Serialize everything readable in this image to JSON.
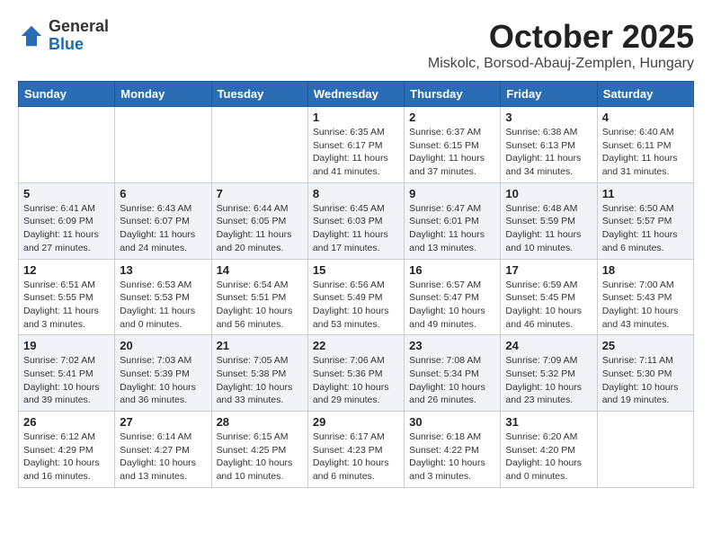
{
  "header": {
    "logo": {
      "general": "General",
      "blue": "Blue"
    },
    "month": "October 2025",
    "location": "Miskolc, Borsod-Abauj-Zemplen, Hungary"
  },
  "weekdays": [
    "Sunday",
    "Monday",
    "Tuesday",
    "Wednesday",
    "Thursday",
    "Friday",
    "Saturday"
  ],
  "weeks": [
    [
      {
        "day": "",
        "info": ""
      },
      {
        "day": "",
        "info": ""
      },
      {
        "day": "",
        "info": ""
      },
      {
        "day": "1",
        "info": "Sunrise: 6:35 AM\nSunset: 6:17 PM\nDaylight: 11 hours\nand 41 minutes."
      },
      {
        "day": "2",
        "info": "Sunrise: 6:37 AM\nSunset: 6:15 PM\nDaylight: 11 hours\nand 37 minutes."
      },
      {
        "day": "3",
        "info": "Sunrise: 6:38 AM\nSunset: 6:13 PM\nDaylight: 11 hours\nand 34 minutes."
      },
      {
        "day": "4",
        "info": "Sunrise: 6:40 AM\nSunset: 6:11 PM\nDaylight: 11 hours\nand 31 minutes."
      }
    ],
    [
      {
        "day": "5",
        "info": "Sunrise: 6:41 AM\nSunset: 6:09 PM\nDaylight: 11 hours\nand 27 minutes."
      },
      {
        "day": "6",
        "info": "Sunrise: 6:43 AM\nSunset: 6:07 PM\nDaylight: 11 hours\nand 24 minutes."
      },
      {
        "day": "7",
        "info": "Sunrise: 6:44 AM\nSunset: 6:05 PM\nDaylight: 11 hours\nand 20 minutes."
      },
      {
        "day": "8",
        "info": "Sunrise: 6:45 AM\nSunset: 6:03 PM\nDaylight: 11 hours\nand 17 minutes."
      },
      {
        "day": "9",
        "info": "Sunrise: 6:47 AM\nSunset: 6:01 PM\nDaylight: 11 hours\nand 13 minutes."
      },
      {
        "day": "10",
        "info": "Sunrise: 6:48 AM\nSunset: 5:59 PM\nDaylight: 11 hours\nand 10 minutes."
      },
      {
        "day": "11",
        "info": "Sunrise: 6:50 AM\nSunset: 5:57 PM\nDaylight: 11 hours\nand 6 minutes."
      }
    ],
    [
      {
        "day": "12",
        "info": "Sunrise: 6:51 AM\nSunset: 5:55 PM\nDaylight: 11 hours\nand 3 minutes."
      },
      {
        "day": "13",
        "info": "Sunrise: 6:53 AM\nSunset: 5:53 PM\nDaylight: 11 hours\nand 0 minutes."
      },
      {
        "day": "14",
        "info": "Sunrise: 6:54 AM\nSunset: 5:51 PM\nDaylight: 10 hours\nand 56 minutes."
      },
      {
        "day": "15",
        "info": "Sunrise: 6:56 AM\nSunset: 5:49 PM\nDaylight: 10 hours\nand 53 minutes."
      },
      {
        "day": "16",
        "info": "Sunrise: 6:57 AM\nSunset: 5:47 PM\nDaylight: 10 hours\nand 49 minutes."
      },
      {
        "day": "17",
        "info": "Sunrise: 6:59 AM\nSunset: 5:45 PM\nDaylight: 10 hours\nand 46 minutes."
      },
      {
        "day": "18",
        "info": "Sunrise: 7:00 AM\nSunset: 5:43 PM\nDaylight: 10 hours\nand 43 minutes."
      }
    ],
    [
      {
        "day": "19",
        "info": "Sunrise: 7:02 AM\nSunset: 5:41 PM\nDaylight: 10 hours\nand 39 minutes."
      },
      {
        "day": "20",
        "info": "Sunrise: 7:03 AM\nSunset: 5:39 PM\nDaylight: 10 hours\nand 36 minutes."
      },
      {
        "day": "21",
        "info": "Sunrise: 7:05 AM\nSunset: 5:38 PM\nDaylight: 10 hours\nand 33 minutes."
      },
      {
        "day": "22",
        "info": "Sunrise: 7:06 AM\nSunset: 5:36 PM\nDaylight: 10 hours\nand 29 minutes."
      },
      {
        "day": "23",
        "info": "Sunrise: 7:08 AM\nSunset: 5:34 PM\nDaylight: 10 hours\nand 26 minutes."
      },
      {
        "day": "24",
        "info": "Sunrise: 7:09 AM\nSunset: 5:32 PM\nDaylight: 10 hours\nand 23 minutes."
      },
      {
        "day": "25",
        "info": "Sunrise: 7:11 AM\nSunset: 5:30 PM\nDaylight: 10 hours\nand 19 minutes."
      }
    ],
    [
      {
        "day": "26",
        "info": "Sunrise: 6:12 AM\nSunset: 4:29 PM\nDaylight: 10 hours\nand 16 minutes."
      },
      {
        "day": "27",
        "info": "Sunrise: 6:14 AM\nSunset: 4:27 PM\nDaylight: 10 hours\nand 13 minutes."
      },
      {
        "day": "28",
        "info": "Sunrise: 6:15 AM\nSunset: 4:25 PM\nDaylight: 10 hours\nand 10 minutes."
      },
      {
        "day": "29",
        "info": "Sunrise: 6:17 AM\nSunset: 4:23 PM\nDaylight: 10 hours\nand 6 minutes."
      },
      {
        "day": "30",
        "info": "Sunrise: 6:18 AM\nSunset: 4:22 PM\nDaylight: 10 hours\nand 3 minutes."
      },
      {
        "day": "31",
        "info": "Sunrise: 6:20 AM\nSunset: 4:20 PM\nDaylight: 10 hours\nand 0 minutes."
      },
      {
        "day": "",
        "info": ""
      }
    ]
  ]
}
